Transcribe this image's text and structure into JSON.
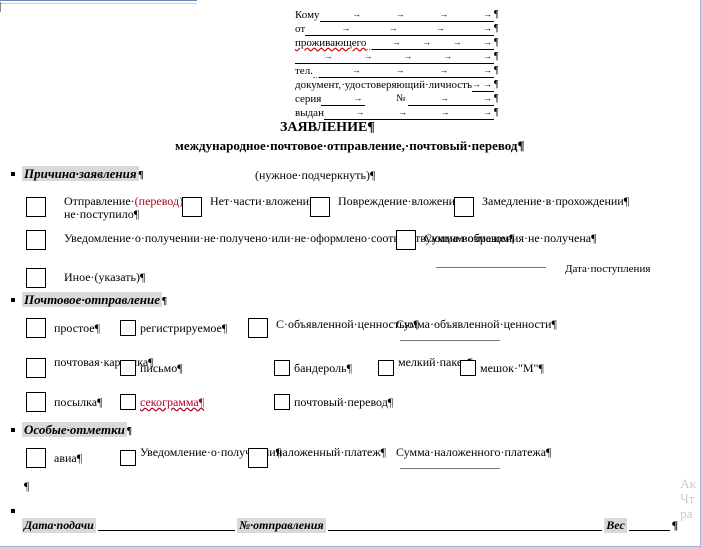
{
  "pilcrow": "¶",
  "arrow": "→",
  "addr": {
    "to": "Кому",
    "from": "от",
    "living": "проживающего",
    "tel": "тел.",
    "doc": "документ,·удостоверяющий·личность",
    "series": "серия",
    "no": "№",
    "issued": "выдан"
  },
  "title": "ЗАЯВЛЕНИЕ¶",
  "subtitle": "международное·почтовое·отправление,·почтовый·перевод¶",
  "note": "(нужное·подчеркнуть)¶",
  "sec1": {
    "h": "Причина·заявления",
    "c1a": "Отправление·",
    "c1b": "(перевод)·",
    "c1c": "не·поступило¶",
    "c2": "Нет·части·вложения¶",
    "c3": "Повреждение·вложения¶",
    "c4": "Замедление·в·прохождении¶",
    "c5": "Уведомление·о·получении·не·получено·или·не·оформлено·соответствующим·образом¶",
    "c6": "Сумма·возмещения·не·получена¶",
    "c7": "Иное·(указать)¶",
    "date": "Дата·поступления"
  },
  "sec2": {
    "h": "Почтовое·отправление",
    "simple": "простое¶",
    "reg": "регистрируемое¶",
    "declared": "С·объявленной·ценностью¶",
    "sumdecl": "Сумма·объявленной·ценности¶",
    "card": "почтовая·карточка¶",
    "letter": "письмо¶",
    "banderol": "бандероль¶",
    "small": "мелкий·пакет¶",
    "bagM": "мешок·\"М\"¶",
    "parcel": "посылка¶",
    "seco": "секограмма¶",
    "transfer": "почтовый·перевод¶"
  },
  "sec3": {
    "h": "Особые·отметки",
    "avia": "авиа¶",
    "notice": "Уведомление·о·получении¶",
    "cod": "наложенный·платеж¶",
    "sumcod": "Сумма·наложенного·платежа¶"
  },
  "footer": {
    "date": "Дата·подачи",
    "no": "№·отправления",
    "weight": "Вес",
    "tail": "¶"
  },
  "clip": {
    "l1": "Ак",
    "l2": "Чт",
    "l3": "ра"
  }
}
